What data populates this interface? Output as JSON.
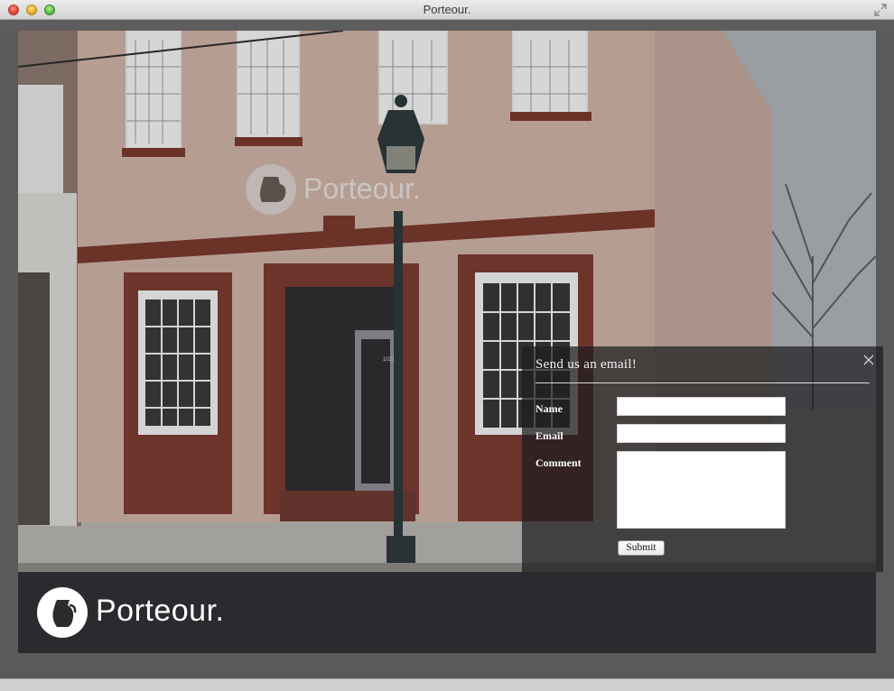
{
  "window": {
    "title": "Porteour."
  },
  "hero": {
    "sign_text": "Porteour.",
    "door_number": "1021"
  },
  "footer": {
    "brand": "Porteour."
  },
  "email_form": {
    "title": "Send us an email!",
    "name_label": "Name",
    "email_label": "Email",
    "comment_label": "Comment",
    "name_value": "",
    "email_value": "",
    "comment_value": "",
    "submit_label": "Submit",
    "close_icon": "close-icon"
  },
  "icons": {
    "logo": "pitcher-icon",
    "window_controls": [
      "close-window-icon",
      "minimize-window-icon",
      "zoom-window-icon"
    ],
    "fullscreen": "fullscreen-icon"
  },
  "colors": {
    "footer_bar": "#28282c",
    "panel_bg": "#1c1c1e",
    "text_light": "#ffffff"
  }
}
